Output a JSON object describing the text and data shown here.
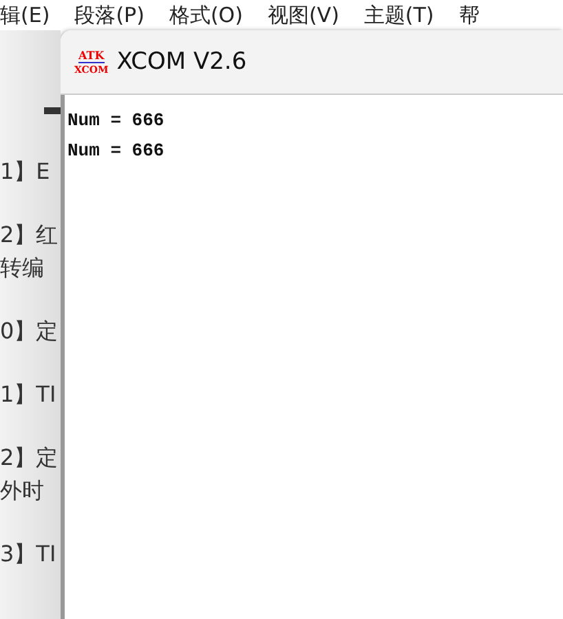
{
  "menu_bar": {
    "items": [
      "辑(E)",
      "段落(P)",
      "格式(O)",
      "视图(V)",
      "主题(T)",
      "帮"
    ]
  },
  "outline": {
    "entries": [
      {
        "lines": [
          "1】E"
        ]
      },
      {
        "lines": [
          "2】红",
          "转编"
        ]
      },
      {
        "lines": [
          "0】定"
        ]
      },
      {
        "lines": [
          "1】TI"
        ]
      },
      {
        "lines": [
          "2】定",
          "外时"
        ]
      },
      {
        "lines": [
          "3】TI"
        ]
      }
    ]
  },
  "window": {
    "logo_top": "ATK",
    "logo_bottom": "XCOM",
    "title": "XCOM V2.6"
  },
  "receive_area": {
    "lines": [
      "Num = 666",
      "Num = 666"
    ]
  }
}
